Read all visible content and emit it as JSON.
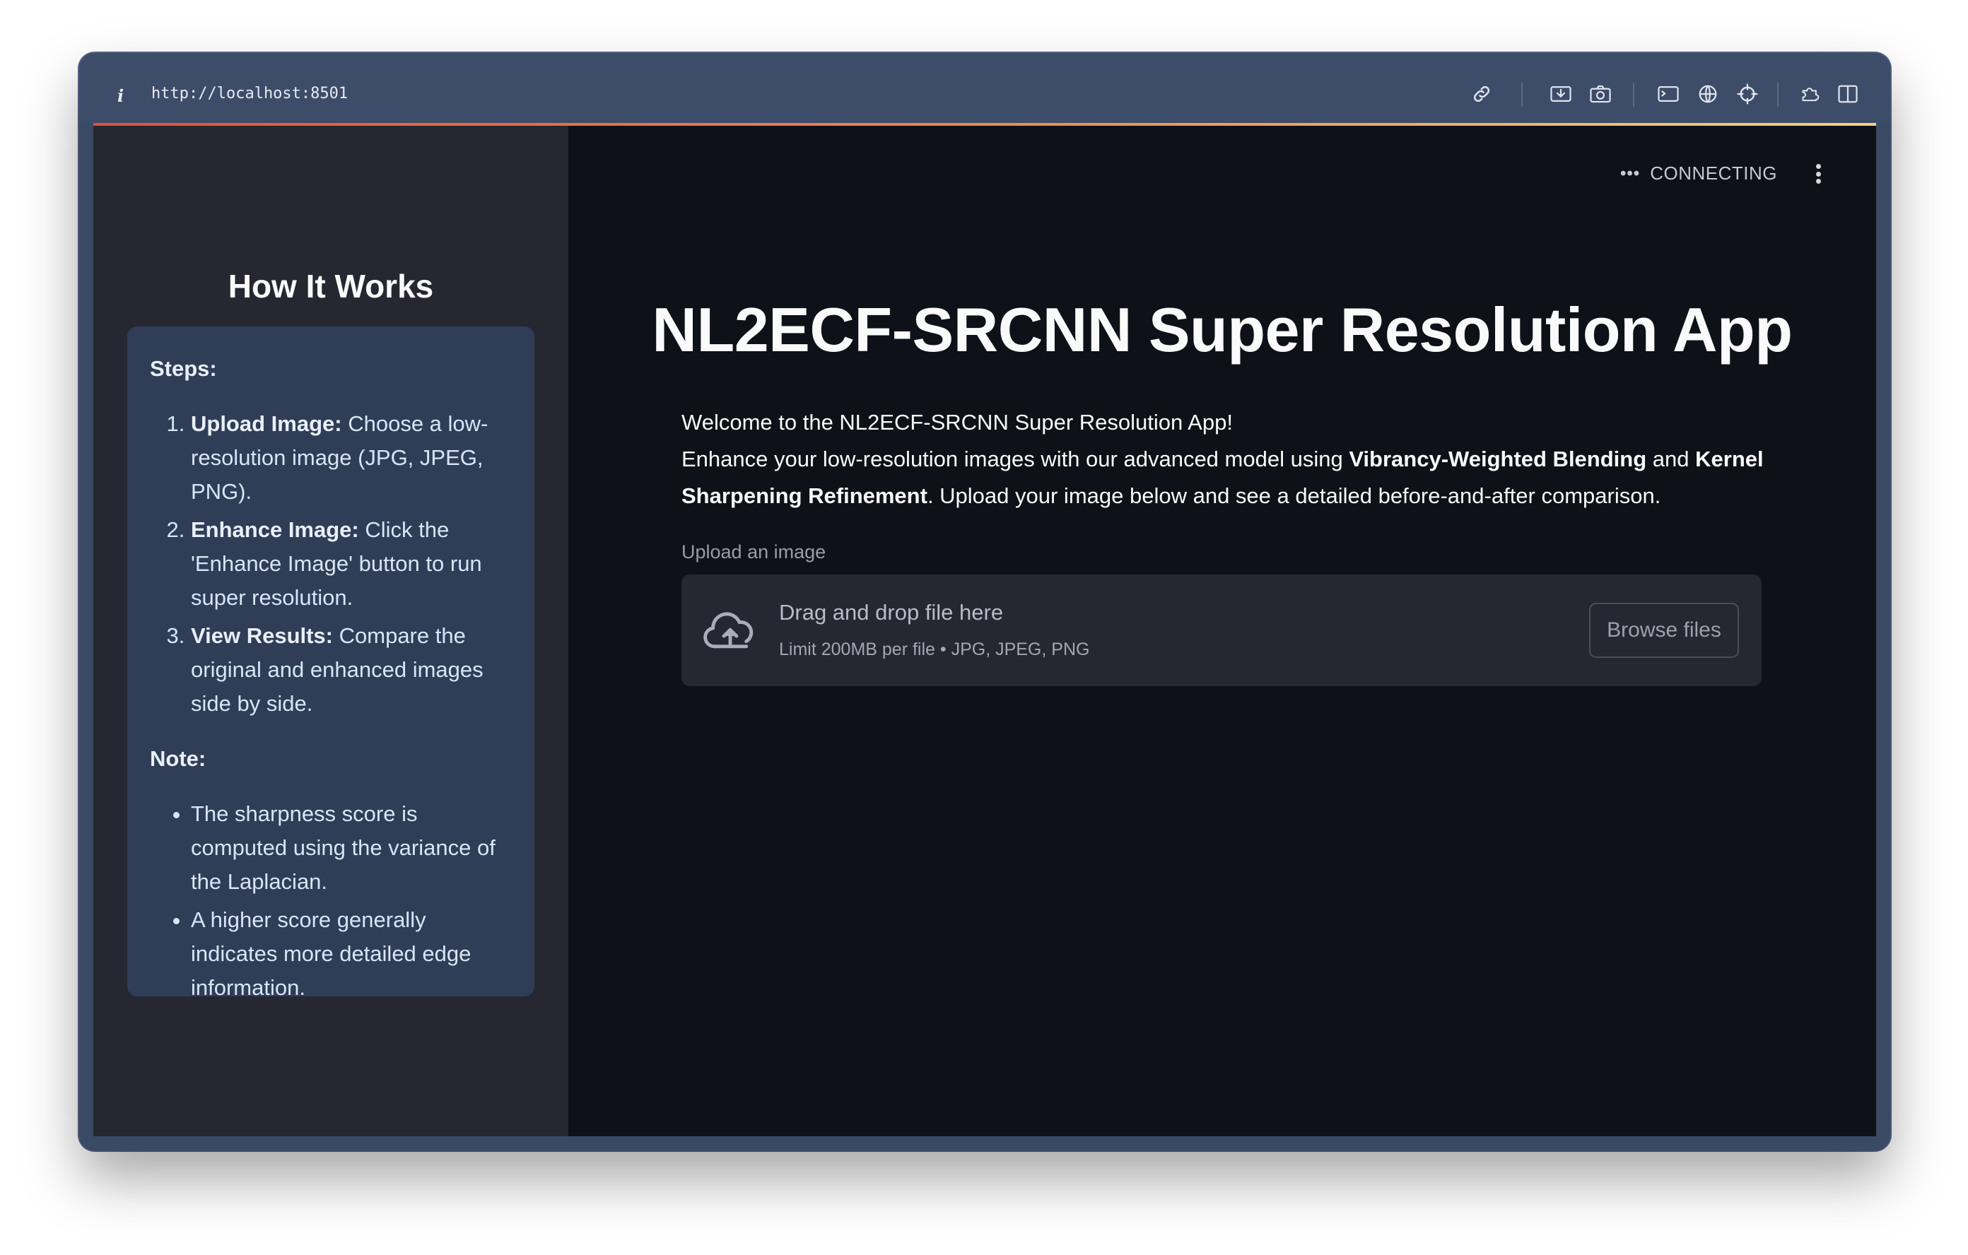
{
  "browser": {
    "info_icon": "i",
    "url": "http://localhost:8501",
    "toolbar_icons": [
      "link-icon",
      "screen-capture-icon",
      "camera-icon",
      "terminal-icon",
      "globe-icon",
      "crosshair-icon",
      "extension-icon",
      "sidebar-toggle-icon"
    ]
  },
  "status": {
    "dots": "•••",
    "label": "CONNECTING"
  },
  "sidebar": {
    "title": "How It Works",
    "steps_label": "Steps:",
    "steps": [
      {
        "title": "Upload Image:",
        "text": " Choose a low-resolution image (JPG, JPEG, PNG)."
      },
      {
        "title": "Enhance Image:",
        "text": " Click the 'Enhance Image' button to run super resolution."
      },
      {
        "title": "View Results:",
        "text": " Compare the original and enhanced images side by side."
      }
    ],
    "note_label": "Note:",
    "notes": [
      "The sharpness score is computed using the variance of the Laplacian.",
      "A higher score generally indicates more detailed edge information."
    ]
  },
  "main": {
    "title": "NL2ECF-SRCNN Super Resolution App",
    "welcome": "Welcome to the NL2ECF-SRCNN Super Resolution App!",
    "desc_1": "Enhance your low-resolution images with our advanced model using ",
    "desc_bold_1": "Vibrancy-Weighted Blending",
    "desc_2": " and ",
    "desc_bold_2": "Kernel Sharpening Refinement",
    "desc_3": ". Upload your image below and see a detailed before-and-after comparison.",
    "upload_label": "Upload an image",
    "dropzone": {
      "main_text": "Drag and drop file here",
      "sub_text": "Limit 200MB per file • JPG, JPEG, PNG",
      "button_label": "Browse files"
    }
  },
  "colors": {
    "sidebar_bg": "#262730",
    "main_bg": "#0e1117",
    "info_box_bg": "#2f3e56",
    "accent_gradient_start": "#e0523e",
    "accent_gradient_end": "#f2d37a"
  }
}
